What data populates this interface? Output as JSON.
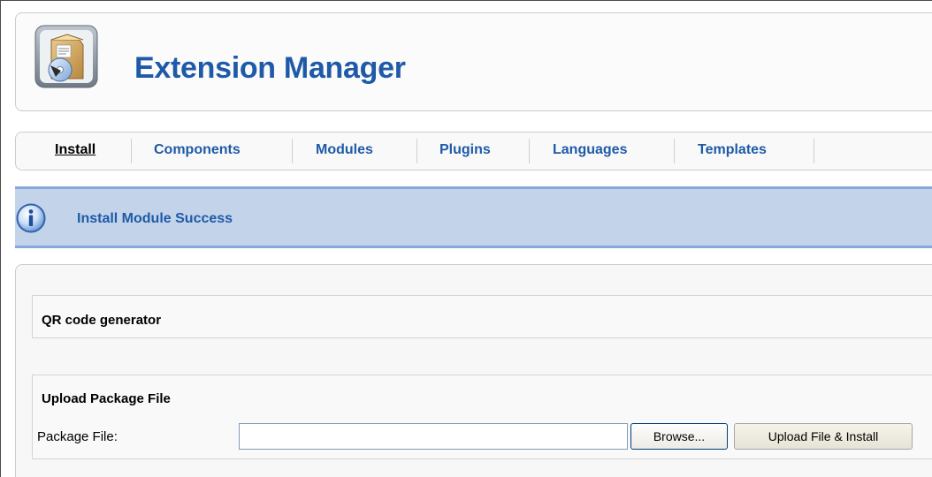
{
  "header": {
    "title": "Extension Manager",
    "icon": "extension-box-icon"
  },
  "tabs": [
    {
      "label": "Install",
      "active": true
    },
    {
      "label": "Components",
      "active": false
    },
    {
      "label": "Modules",
      "active": false
    },
    {
      "label": "Plugins",
      "active": false
    },
    {
      "label": "Languages",
      "active": false
    },
    {
      "label": "Templates",
      "active": false
    }
  ],
  "message": {
    "icon": "info-icon",
    "text": "Install Module Success"
  },
  "module": {
    "name": "QR code generator"
  },
  "upload": {
    "title": "Upload Package File",
    "field_label": "Package File:",
    "field_value": "",
    "browse_label": "Browse...",
    "submit_label": "Upload File & Install"
  },
  "colors": {
    "accent": "#1e5aa8",
    "message_bg": "#c3d3ea",
    "message_border": "#86a9d9"
  }
}
